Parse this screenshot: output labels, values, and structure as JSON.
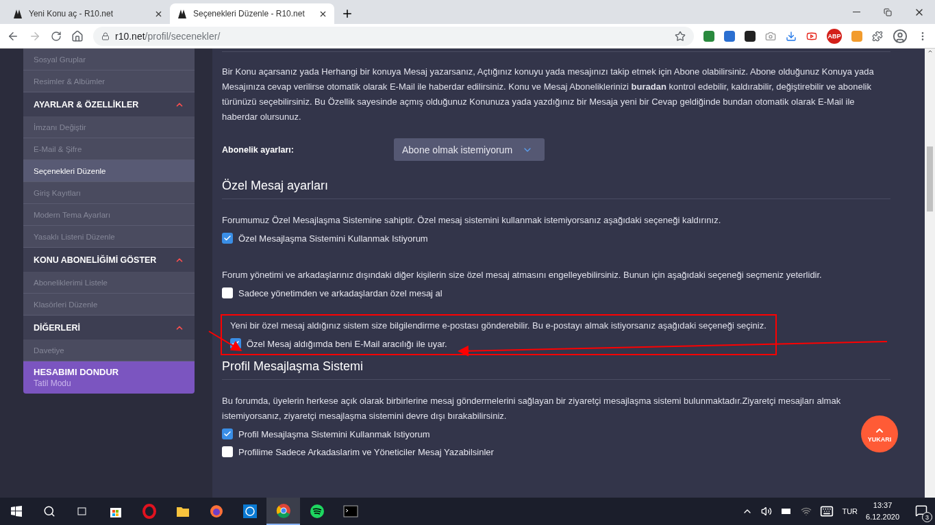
{
  "browser": {
    "tabs": [
      {
        "title": "Yeni Konu aç - R10.net",
        "selected": false
      },
      {
        "title": "Seçenekleri Düzenle - R10.net",
        "selected": true
      }
    ],
    "address": {
      "host": "r10.net",
      "path": "/profil/secenekler/"
    },
    "extension_label": "ABP"
  },
  "sidebar": {
    "items": [
      {
        "kind": "link",
        "label": "Sosyal Gruplar",
        "selected": false
      },
      {
        "kind": "link",
        "label": "Resimler & Albümler",
        "selected": false
      },
      {
        "kind": "header",
        "label": "AYARLAR & ÖZELLİKLER",
        "expanded": true
      },
      {
        "kind": "link",
        "label": "İmzanı Değiştir",
        "selected": false
      },
      {
        "kind": "link",
        "label": "E-Mail & Şifre",
        "selected": false
      },
      {
        "kind": "link",
        "label": "Seçenekleri Düzenle",
        "selected": true
      },
      {
        "kind": "link",
        "label": "Giriş Kayıtları",
        "selected": false
      },
      {
        "kind": "link",
        "label": "Modern Tema Ayarları",
        "selected": false
      },
      {
        "kind": "link",
        "label": "Yasaklı Listeni Düzenle",
        "selected": false
      },
      {
        "kind": "header",
        "label": "KONU ABONELİĞİMİ GÖSTER",
        "expanded": true
      },
      {
        "kind": "link",
        "label": "Aboneliklerimi Listele",
        "selected": false
      },
      {
        "kind": "link",
        "label": "Klasörleri Düzenle",
        "selected": false
      },
      {
        "kind": "header",
        "label": "DİĞERLERİ",
        "expanded": true
      },
      {
        "kind": "link",
        "label": "Davetiye",
        "selected": false
      },
      {
        "kind": "promo",
        "label": "HESABIMI DONDUR",
        "subtitle": "Tatil Modu"
      }
    ]
  },
  "content": {
    "blocks": [
      {
        "kind": "paragraph",
        "text": "Bir Konu açarsanız yada Herhangi bir konuya Mesaj yazarsanız, Açtığınız konuyu yada mesajınızı takip etmek için Abone olabilirsiniz. Abone olduğunuz Konuya yada Mesajınıza cevap verilirse otomatik olarak E-Mail ile haberdar edilirsiniz. Konu ve Mesaj Aboneliklerinizi **buradan** kontrol edebilir, kaldırabilir, değiştirebilir ve abonelik türünüzü seçebilirsiniz. Bu Özellik sayesinde açmış olduğunuz Konunuza yada yazdığınız bir Mesaja yeni bir Cevap geldiğinde bundan otomatik olarak E-Mail ile haberdar olursunuz."
      },
      {
        "kind": "select_row",
        "label": "Abonelik ayarları:",
        "value": "Abone olmak istemiyorum"
      },
      {
        "kind": "heading",
        "text": "Özel Mesaj ayarları"
      },
      {
        "kind": "option_group",
        "highlighted": false,
        "text": "Forumumuz Özel Mesajlaşma Sistemine sahiptir. Özel mesaj sistemini kullanmak istemiyorsanız aşağıdaki seçeneği kaldırınız.",
        "options": [
          {
            "label": "Özel Mesajlaşma Sistemini Kullanmak Istiyorum",
            "checked": true
          }
        ]
      },
      {
        "kind": "option_group",
        "highlighted": false,
        "text": "Forum yönetimi ve arkadaşlarınız dışındaki diğer kişilerin size özel mesaj atmasını engelleyebilirsiniz. Bunun için aşağıdaki seçeneği seçmeniz yeterlidir.",
        "options": [
          {
            "label": "Sadece yönetimden ve arkadaşlardan özel mesaj al",
            "checked": false
          }
        ]
      },
      {
        "kind": "option_group",
        "highlighted": true,
        "text": "Yeni bir özel mesaj aldığınız sistem size bilgilendirme e-postası gönderebilir. Bu e-postayı almak istiyorsanız aşağıdaki seçeneği seçiniz.",
        "options": [
          {
            "label": "Özel Mesaj aldığımda beni E-Mail aracılığı ile uyar.",
            "checked": true
          }
        ]
      },
      {
        "kind": "heading",
        "text": "Profil Mesajlaşma Sistemi"
      },
      {
        "kind": "option_group",
        "highlighted": false,
        "text": "Bu forumda, üyelerin herkese açık olarak birbirlerine mesaj göndermelerini sağlayan bir ziyaretçi mesajlaşma sistemi bulunmaktadır.Ziyaretçi mesajları almak istemiyorsanız, ziyaretçi mesajlaşma sistemini devre dışı bırakabilirsiniz.",
        "options": [
          {
            "label": "Profil Mesajlaşma Sistemini Kullanmak Istiyorum",
            "checked": true
          },
          {
            "label": "Profilime Sadece Arkadaslarim ve Yöneticiler Mesaj Yazabilsinler",
            "checked": false
          }
        ]
      }
    ]
  },
  "scroll_top": {
    "label": "YUKARI"
  },
  "taskbar": {
    "apps": [
      {
        "kind": "store",
        "selected": false
      },
      {
        "kind": "opera",
        "selected": false
      },
      {
        "kind": "folder",
        "selected": false
      },
      {
        "kind": "firefox",
        "selected": false
      },
      {
        "kind": "whatsapp",
        "selected": false
      },
      {
        "kind": "chrome",
        "selected": true
      },
      {
        "kind": "spotify",
        "selected": false
      },
      {
        "kind": "terminal",
        "selected": false
      }
    ],
    "language": "TUR",
    "time": "13:37",
    "date": "6.12.2020",
    "notifications": "3"
  }
}
